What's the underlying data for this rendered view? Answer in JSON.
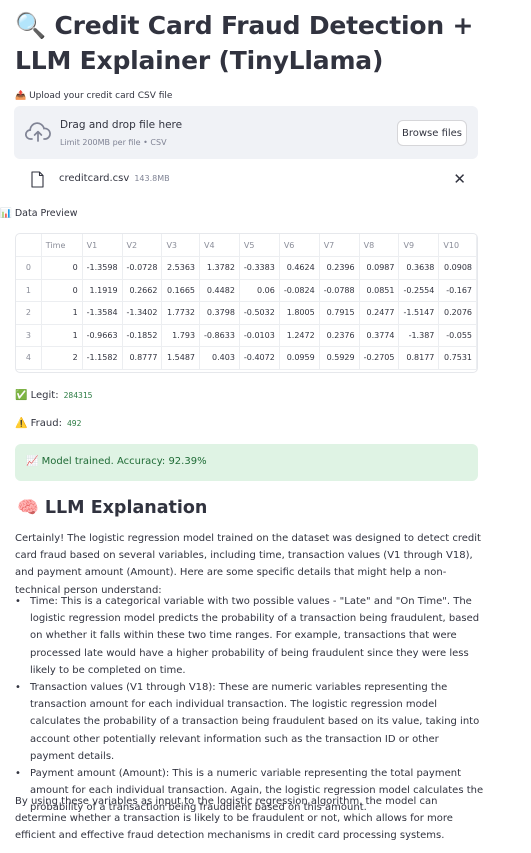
{
  "header": {
    "icon": "🔍",
    "title": "Credit Card Fraud Detection + LLM Explainer (TinyLlama)"
  },
  "uploader": {
    "label": "📤 Upload your credit card CSV file",
    "drop_text": "Drag and drop file here",
    "limit_text": "Limit 200MB per file • CSV",
    "browse_label": "Browse files",
    "file_name": "creditcard.csv",
    "file_size": "143.8MB",
    "remove_glyph": "✕"
  },
  "preview": {
    "label": "📊 Data Preview",
    "columns": [
      "",
      "Time",
      "V1",
      "V2",
      "V3",
      "V4",
      "V5",
      "V6",
      "V7",
      "V8",
      "V9",
      "V10"
    ],
    "rows": [
      [
        "0",
        "0",
        "-1.3598",
        "-0.0728",
        "2.5363",
        "1.3782",
        "-0.3383",
        "0.4624",
        "0.2396",
        "0.0987",
        "0.3638",
        "0.0908"
      ],
      [
        "1",
        "0",
        "1.1919",
        "0.2662",
        "0.1665",
        "0.4482",
        "0.06",
        "-0.0824",
        "-0.0788",
        "0.0851",
        "-0.2554",
        "-0.167"
      ],
      [
        "2",
        "1",
        "-1.3584",
        "-1.3402",
        "1.7732",
        "0.3798",
        "-0.5032",
        "1.8005",
        "0.7915",
        "0.2477",
        "-1.5147",
        "0.2076"
      ],
      [
        "3",
        "1",
        "-0.9663",
        "-0.1852",
        "1.793",
        "-0.8633",
        "-0.0103",
        "1.2472",
        "0.2376",
        "0.3774",
        "-1.387",
        "-0.055"
      ],
      [
        "4",
        "2",
        "-1.1582",
        "0.8777",
        "1.5487",
        "0.403",
        "-0.4072",
        "0.0959",
        "0.5929",
        "-0.2705",
        "0.8177",
        "0.7531"
      ]
    ]
  },
  "stats": {
    "legit_label": "✅ Legit:",
    "legit_value": "284315",
    "fraud_label": "⚠️ Fraud:",
    "fraud_value": "492"
  },
  "status": {
    "message": "📈 Model trained. Accuracy: 92.39%"
  },
  "explanation": {
    "heading": "🧠 LLM Explanation",
    "intro": "Certainly! The logistic regression model trained on the dataset was designed to detect credit card fraud based on several variables, including time, transaction values (V1 through V18), and payment amount (Amount). Here are some specific details that might help a non-technical person understand:",
    "bullets": [
      "Time: This is a categorical variable with two possible values - \"Late\" and \"On Time\". The logistic regression model predicts the probability of a transaction being fraudulent, based on whether it falls within these two time ranges. For example, transactions that were processed late would have a higher probability of being fraudulent since they were less likely to be completed on time.",
      "Transaction values (V1 through V18): These are numeric variables representing the transaction amount for each individual transaction. The logistic regression model calculates the probability of a transaction being fraudulent based on its value, taking into account other potentially relevant information such as the transaction ID or other payment details.",
      "Payment amount (Amount): This is a numeric variable representing the total payment amount for each individual transaction. Again, the logistic regression model calculates the probability of a transaction being fraudulent based on this amount."
    ],
    "conclusion": "By using these variables as input to the logistic regression algorithm, the model can determine whether a transaction is likely to be fraudulent or not, which allows for more efficient and effective fraud detection mechanisms in credit card processing systems."
  },
  "colors": {
    "success_bg": "#dff3e4",
    "success_text": "#1f6b36",
    "dropzone_bg": "#f0f2f6",
    "text": "#31333f"
  }
}
